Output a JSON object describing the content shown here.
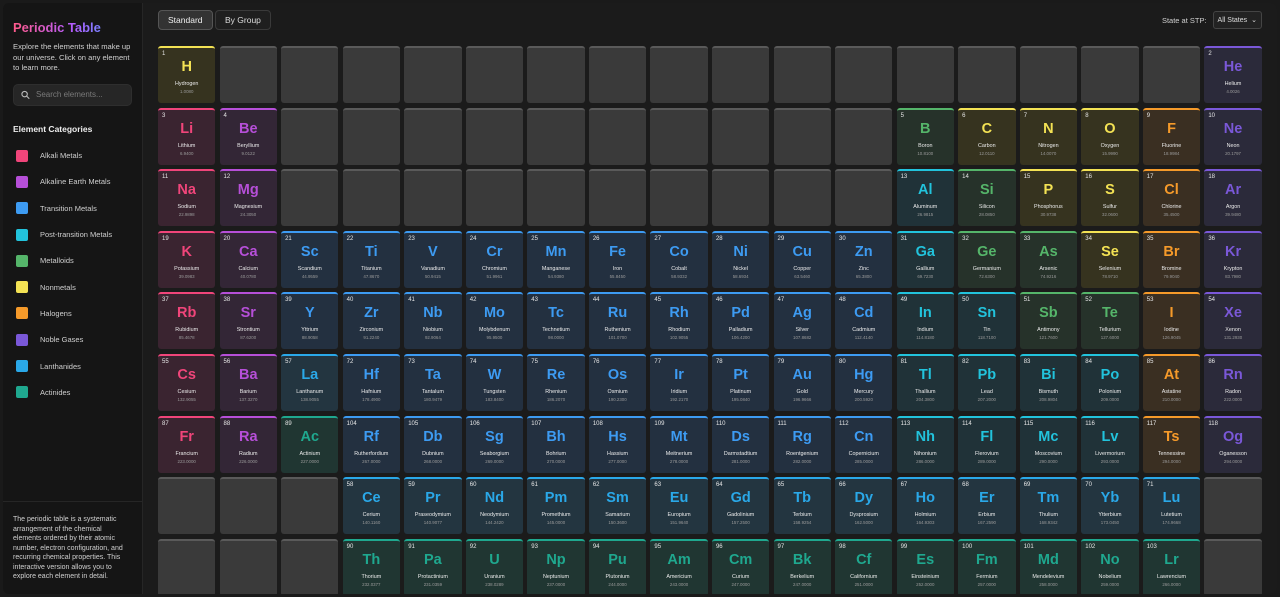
{
  "sidebar": {
    "title": "Periodic Table",
    "intro": "Explore the elements that make up our universe. Click on any element to learn more.",
    "search_placeholder": "Search elements...",
    "categories_title": "Element Categories",
    "categories": [
      {
        "key": "alkali",
        "label": "Alkali Metals",
        "color": "#f0457a",
        "bg": "#3a2430"
      },
      {
        "key": "alkaline",
        "label": "Alkaline Earth Metals",
        "color": "#b64fd8",
        "bg": "#332636"
      },
      {
        "key": "transition",
        "label": "Transition Metals",
        "color": "#3d9bf2",
        "bg": "#233040"
      },
      {
        "key": "post",
        "label": "Post-transition Metals",
        "color": "#22c3dc",
        "bg": "#203238"
      },
      {
        "key": "metalloid",
        "label": "Metalloids",
        "color": "#55b56a",
        "bg": "#26322a"
      },
      {
        "key": "nonmetal",
        "label": "Nonmetals",
        "color": "#f3e254",
        "bg": "#36331f"
      },
      {
        "key": "halogen",
        "label": "Halogens",
        "color": "#f59a2a",
        "bg": "#3a2f22"
      },
      {
        "key": "noble",
        "label": "Noble Gases",
        "color": "#7a58d8",
        "bg": "#2b2a3a"
      },
      {
        "key": "lanthanide",
        "label": "Lanthanides",
        "color": "#2aa8e8",
        "bg": "#233540"
      },
      {
        "key": "actinide",
        "label": "Actinides",
        "color": "#1fa88f",
        "bg": "#203632"
      }
    ],
    "about": "The periodic table is a systematic arrangement of the chemical elements ordered by their atomic number, electron configuration, and recurring chemical properties. This interactive version allows you to explore each element in detail."
  },
  "toolbar": {
    "standard_label": "Standard",
    "group_label": "By Group",
    "state_label": "State at STP:",
    "state_value": "All States"
  },
  "elements": [
    [
      1,
      "H",
      "Hydrogen",
      "1.0080",
      "nonmetal",
      1,
      1
    ],
    [
      2,
      "He",
      "Helium",
      "4.0026",
      "noble",
      1,
      18
    ],
    [
      3,
      "Li",
      "Lithium",
      "6.9400",
      "alkali",
      2,
      1
    ],
    [
      4,
      "Be",
      "Beryllium",
      "9.0122",
      "alkaline",
      2,
      2
    ],
    [
      5,
      "B",
      "Boron",
      "10.8100",
      "metalloid",
      2,
      13
    ],
    [
      6,
      "C",
      "Carbon",
      "12.0110",
      "nonmetal",
      2,
      14
    ],
    [
      7,
      "N",
      "Nitrogen",
      "14.0070",
      "nonmetal",
      2,
      15
    ],
    [
      8,
      "O",
      "Oxygen",
      "15.9990",
      "nonmetal",
      2,
      16
    ],
    [
      9,
      "F",
      "Fluorine",
      "18.9984",
      "halogen",
      2,
      17
    ],
    [
      10,
      "Ne",
      "Neon",
      "20.1797",
      "noble",
      2,
      18
    ],
    [
      11,
      "Na",
      "Sodium",
      "22.9898",
      "alkali",
      3,
      1
    ],
    [
      12,
      "Mg",
      "Magnesium",
      "24.3050",
      "alkaline",
      3,
      2
    ],
    [
      13,
      "Al",
      "Aluminum",
      "26.9815",
      "post",
      3,
      13
    ],
    [
      14,
      "Si",
      "Silicon",
      "28.0850",
      "metalloid",
      3,
      14
    ],
    [
      15,
      "P",
      "Phosphorus",
      "30.9738",
      "nonmetal",
      3,
      15
    ],
    [
      16,
      "S",
      "Sulfur",
      "32.0600",
      "nonmetal",
      3,
      16
    ],
    [
      17,
      "Cl",
      "Chlorine",
      "35.4500",
      "halogen",
      3,
      17
    ],
    [
      18,
      "Ar",
      "Argon",
      "39.9480",
      "noble",
      3,
      18
    ],
    [
      19,
      "K",
      "Potassium",
      "39.0983",
      "alkali",
      4,
      1
    ],
    [
      20,
      "Ca",
      "Calcium",
      "40.0780",
      "alkaline",
      4,
      2
    ],
    [
      21,
      "Sc",
      "Scandium",
      "44.9559",
      "transition",
      4,
      3
    ],
    [
      22,
      "Ti",
      "Titanium",
      "47.8670",
      "transition",
      4,
      4
    ],
    [
      23,
      "V",
      "Vanadium",
      "50.9415",
      "transition",
      4,
      5
    ],
    [
      24,
      "Cr",
      "Chromium",
      "51.9961",
      "transition",
      4,
      6
    ],
    [
      25,
      "Mn",
      "Manganese",
      "54.9380",
      "transition",
      4,
      7
    ],
    [
      26,
      "Fe",
      "Iron",
      "55.8450",
      "transition",
      4,
      8
    ],
    [
      27,
      "Co",
      "Cobalt",
      "58.9332",
      "transition",
      4,
      9
    ],
    [
      28,
      "Ni",
      "Nickel",
      "58.6934",
      "transition",
      4,
      10
    ],
    [
      29,
      "Cu",
      "Copper",
      "63.5460",
      "transition",
      4,
      11
    ],
    [
      30,
      "Zn",
      "Zinc",
      "65.3800",
      "transition",
      4,
      12
    ],
    [
      31,
      "Ga",
      "Gallium",
      "69.7230",
      "post",
      4,
      13
    ],
    [
      32,
      "Ge",
      "Germanium",
      "72.6300",
      "metalloid",
      4,
      14
    ],
    [
      33,
      "As",
      "Arsenic",
      "74.9216",
      "metalloid",
      4,
      15
    ],
    [
      34,
      "Se",
      "Selenium",
      "78.9710",
      "nonmetal",
      4,
      16
    ],
    [
      35,
      "Br",
      "Bromine",
      "79.9040",
      "halogen",
      4,
      17
    ],
    [
      36,
      "Kr",
      "Krypton",
      "83.7980",
      "noble",
      4,
      18
    ],
    [
      37,
      "Rb",
      "Rubidium",
      "85.4678",
      "alkali",
      5,
      1
    ],
    [
      38,
      "Sr",
      "Strontium",
      "87.6200",
      "alkaline",
      5,
      2
    ],
    [
      39,
      "Y",
      "Yttrium",
      "88.9058",
      "transition",
      5,
      3
    ],
    [
      40,
      "Zr",
      "Zirconium",
      "91.2240",
      "transition",
      5,
      4
    ],
    [
      41,
      "Nb",
      "Niobium",
      "92.9064",
      "transition",
      5,
      5
    ],
    [
      42,
      "Mo",
      "Molybdenum",
      "95.9500",
      "transition",
      5,
      6
    ],
    [
      43,
      "Tc",
      "Technetium",
      "98.0000",
      "transition",
      5,
      7
    ],
    [
      44,
      "Ru",
      "Ruthenium",
      "101.0700",
      "transition",
      5,
      8
    ],
    [
      45,
      "Rh",
      "Rhodium",
      "102.9055",
      "transition",
      5,
      9
    ],
    [
      46,
      "Pd",
      "Palladium",
      "106.4200",
      "transition",
      5,
      10
    ],
    [
      47,
      "Ag",
      "Silver",
      "107.8682",
      "transition",
      5,
      11
    ],
    [
      48,
      "Cd",
      "Cadmium",
      "112.4140",
      "transition",
      5,
      12
    ],
    [
      49,
      "In",
      "Indium",
      "114.8180",
      "post",
      5,
      13
    ],
    [
      50,
      "Sn",
      "Tin",
      "118.7100",
      "post",
      5,
      14
    ],
    [
      51,
      "Sb",
      "Antimony",
      "121.7600",
      "metalloid",
      5,
      15
    ],
    [
      52,
      "Te",
      "Tellurium",
      "127.6000",
      "metalloid",
      5,
      16
    ],
    [
      53,
      "I",
      "Iodine",
      "126.9045",
      "halogen",
      5,
      17
    ],
    [
      54,
      "Xe",
      "Xenon",
      "131.2930",
      "noble",
      5,
      18
    ],
    [
      55,
      "Cs",
      "Cesium",
      "132.9055",
      "alkali",
      6,
      1
    ],
    [
      56,
      "Ba",
      "Barium",
      "137.3270",
      "alkaline",
      6,
      2
    ],
    [
      57,
      "La",
      "Lanthanum",
      "138.9055",
      "lanthanide",
      6,
      3
    ],
    [
      72,
      "Hf",
      "Hafnium",
      "178.4900",
      "transition",
      6,
      4
    ],
    [
      73,
      "Ta",
      "Tantalum",
      "180.9479",
      "transition",
      6,
      5
    ],
    [
      74,
      "W",
      "Tungsten",
      "183.8400",
      "transition",
      6,
      6
    ],
    [
      75,
      "Re",
      "Rhenium",
      "186.2070",
      "transition",
      6,
      7
    ],
    [
      76,
      "Os",
      "Osmium",
      "190.2300",
      "transition",
      6,
      8
    ],
    [
      77,
      "Ir",
      "Iridium",
      "192.2170",
      "transition",
      6,
      9
    ],
    [
      78,
      "Pt",
      "Platinum",
      "195.0840",
      "transition",
      6,
      10
    ],
    [
      79,
      "Au",
      "Gold",
      "196.9666",
      "transition",
      6,
      11
    ],
    [
      80,
      "Hg",
      "Mercury",
      "200.5920",
      "transition",
      6,
      12
    ],
    [
      81,
      "Tl",
      "Thallium",
      "204.3800",
      "post",
      6,
      13
    ],
    [
      82,
      "Pb",
      "Lead",
      "207.2000",
      "post",
      6,
      14
    ],
    [
      83,
      "Bi",
      "Bismuth",
      "208.9804",
      "post",
      6,
      15
    ],
    [
      84,
      "Po",
      "Polonium",
      "209.0000",
      "post",
      6,
      16
    ],
    [
      85,
      "At",
      "Astatine",
      "210.0000",
      "halogen",
      6,
      17
    ],
    [
      86,
      "Rn",
      "Radon",
      "222.0000",
      "noble",
      6,
      18
    ],
    [
      87,
      "Fr",
      "Francium",
      "223.0000",
      "alkali",
      7,
      1
    ],
    [
      88,
      "Ra",
      "Radium",
      "226.0000",
      "alkaline",
      7,
      2
    ],
    [
      89,
      "Ac",
      "Actinium",
      "227.0000",
      "actinide",
      7,
      3
    ],
    [
      104,
      "Rf",
      "Rutherfordium",
      "267.0000",
      "transition",
      7,
      4
    ],
    [
      105,
      "Db",
      "Dubnium",
      "268.0000",
      "transition",
      7,
      5
    ],
    [
      106,
      "Sg",
      "Seaborgium",
      "269.0000",
      "transition",
      7,
      6
    ],
    [
      107,
      "Bh",
      "Bohrium",
      "270.0000",
      "transition",
      7,
      7
    ],
    [
      108,
      "Hs",
      "Hassium",
      "277.0000",
      "transition",
      7,
      8
    ],
    [
      109,
      "Mt",
      "Meitnerium",
      "278.0000",
      "transition",
      7,
      9
    ],
    [
      110,
      "Ds",
      "Darmstadtium",
      "281.0000",
      "transition",
      7,
      10
    ],
    [
      111,
      "Rg",
      "Roentgenium",
      "282.0000",
      "transition",
      7,
      11
    ],
    [
      112,
      "Cn",
      "Copernicium",
      "285.0000",
      "transition",
      7,
      12
    ],
    [
      113,
      "Nh",
      "Nihonium",
      "286.0000",
      "post",
      7,
      13
    ],
    [
      114,
      "Fl",
      "Flerovium",
      "289.0000",
      "post",
      7,
      14
    ],
    [
      115,
      "Mc",
      "Moscovium",
      "290.0000",
      "post",
      7,
      15
    ],
    [
      116,
      "Lv",
      "Livermorium",
      "293.0000",
      "post",
      7,
      16
    ],
    [
      117,
      "Ts",
      "Tennessine",
      "294.0000",
      "halogen",
      7,
      17
    ],
    [
      118,
      "Og",
      "Oganesson",
      "294.0000",
      "noble",
      7,
      18
    ],
    [
      58,
      "Ce",
      "Cerium",
      "140.1160",
      "lanthanide",
      8,
      4
    ],
    [
      59,
      "Pr",
      "Praseodymium",
      "140.9077",
      "lanthanide",
      8,
      5
    ],
    [
      60,
      "Nd",
      "Neodymium",
      "144.2420",
      "lanthanide",
      8,
      6
    ],
    [
      61,
      "Pm",
      "Promethium",
      "145.0000",
      "lanthanide",
      8,
      7
    ],
    [
      62,
      "Sm",
      "Samarium",
      "150.3600",
      "lanthanide",
      8,
      8
    ],
    [
      63,
      "Eu",
      "Europium",
      "151.9640",
      "lanthanide",
      8,
      9
    ],
    [
      64,
      "Gd",
      "Gadolinium",
      "157.2500",
      "lanthanide",
      8,
      10
    ],
    [
      65,
      "Tb",
      "Terbium",
      "158.9254",
      "lanthanide",
      8,
      11
    ],
    [
      66,
      "Dy",
      "Dysprosium",
      "162.5000",
      "lanthanide",
      8,
      12
    ],
    [
      67,
      "Ho",
      "Holmium",
      "164.9303",
      "lanthanide",
      8,
      13
    ],
    [
      68,
      "Er",
      "Erbium",
      "167.2590",
      "lanthanide",
      8,
      14
    ],
    [
      69,
      "Tm",
      "Thulium",
      "168.9342",
      "lanthanide",
      8,
      15
    ],
    [
      70,
      "Yb",
      "Ytterbium",
      "173.0450",
      "lanthanide",
      8,
      16
    ],
    [
      71,
      "Lu",
      "Lutetium",
      "174.9668",
      "lanthanide",
      8,
      17
    ],
    [
      90,
      "Th",
      "Thorium",
      "232.0377",
      "actinide",
      9,
      4
    ],
    [
      91,
      "Pa",
      "Protactinium",
      "231.0359",
      "actinide",
      9,
      5
    ],
    [
      92,
      "U",
      "Uranium",
      "238.0289",
      "actinide",
      9,
      6
    ],
    [
      93,
      "Np",
      "Neptunium",
      "237.0000",
      "actinide",
      9,
      7
    ],
    [
      94,
      "Pu",
      "Plutonium",
      "244.0000",
      "actinide",
      9,
      8
    ],
    [
      95,
      "Am",
      "Americium",
      "243.0000",
      "actinide",
      9,
      9
    ],
    [
      96,
      "Cm",
      "Curium",
      "247.0000",
      "actinide",
      9,
      10
    ],
    [
      97,
      "Bk",
      "Berkelium",
      "247.0000",
      "actinide",
      9,
      11
    ],
    [
      98,
      "Cf",
      "Californium",
      "251.0000",
      "actinide",
      9,
      12
    ],
    [
      99,
      "Es",
      "Einsteinium",
      "252.0000",
      "actinide",
      9,
      13
    ],
    [
      100,
      "Fm",
      "Fermium",
      "257.0000",
      "actinide",
      9,
      14
    ],
    [
      101,
      "Md",
      "Mendelevium",
      "258.0000",
      "actinide",
      9,
      15
    ],
    [
      102,
      "No",
      "Nobelium",
      "259.0000",
      "actinide",
      9,
      16
    ],
    [
      103,
      "Lr",
      "Lawrencium",
      "266.0000",
      "actinide",
      9,
      17
    ]
  ]
}
